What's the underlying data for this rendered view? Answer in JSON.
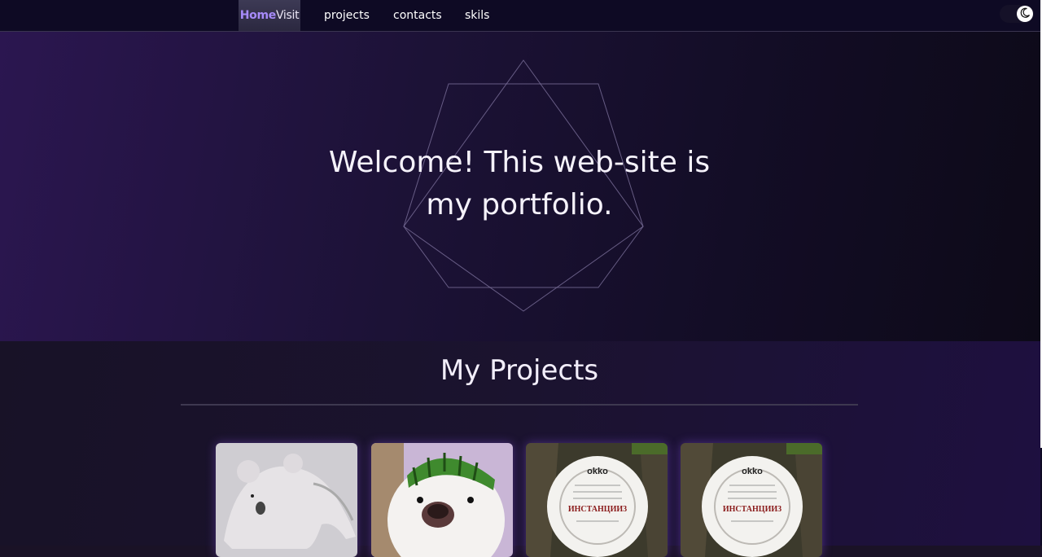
{
  "nav": {
    "brand_home": "Home",
    "brand_visit": "Visit",
    "links": [
      "projects",
      "contacts",
      "skils"
    ]
  },
  "hero": {
    "title": "Welcome! This web-site is my portfolio."
  },
  "projects": {
    "title": "My Projects",
    "cards": [
      {
        "name": "koala-plush-photo"
      },
      {
        "name": "dog-with-watermelon-helmet-photo"
      },
      {
        "name": "okko-instancii-3-plate-photo"
      },
      {
        "name": "okko-instancii-3-plate-photo"
      }
    ],
    "plate_brand": "okko",
    "plate_text": "ИНСТАНЦИИ3"
  },
  "colors": {
    "accent": "#a78bfa",
    "nav_bg": "#0e0a24",
    "hero_bg": "#1c1236"
  },
  "icons": {
    "theme_toggle": "moon-icon"
  }
}
